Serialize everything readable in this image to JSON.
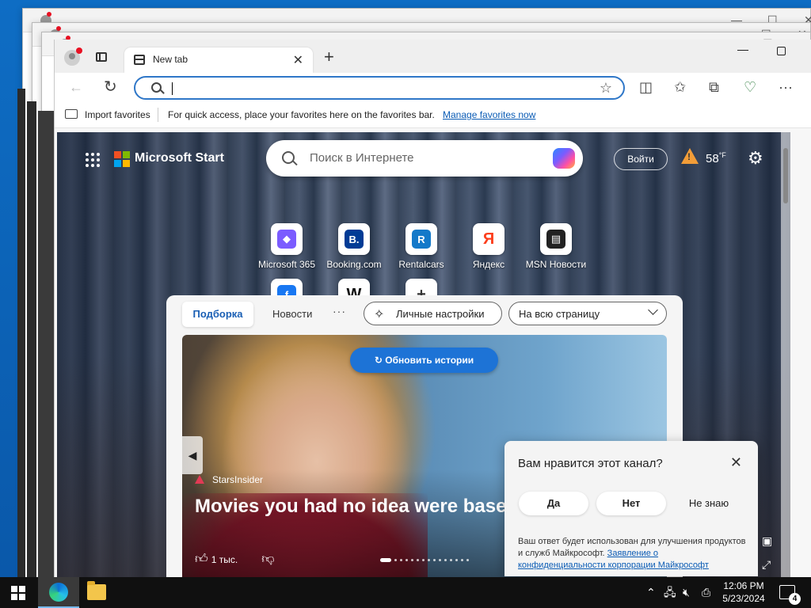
{
  "browser": {
    "tab_title": "New tab",
    "tab_close": "✕",
    "new_tab_symbol": "+",
    "address_value": "",
    "favorites": {
      "import_label": "Import favorites",
      "message": "For quick access, place your favorites here on the favorites bar.",
      "manage_link": "Manage favorites now"
    }
  },
  "start": {
    "brand": "Microsoft Start",
    "search_placeholder": "Поиск в Интернете",
    "login_label": "Войти",
    "temperature": "58",
    "temp_unit": "°F",
    "quick_links": [
      {
        "label": "Microsoft 365",
        "glyph": "◆",
        "color": "#7b5cff"
      },
      {
        "label": "Booking.com",
        "glyph": "B.",
        "color": "#003b95"
      },
      {
        "label": "Rentalcars",
        "glyph": "R",
        "color": "#1479c9"
      },
      {
        "label": "Яндекс",
        "glyph": "Я",
        "color": "#fc3f1d"
      },
      {
        "label": "MSN Новости",
        "glyph": "▤",
        "color": "#222222"
      },
      {
        "label": "Facebook",
        "glyph": "f",
        "color": "#1877f2"
      },
      {
        "label": "Википедия",
        "glyph": "W",
        "color": "#111111"
      },
      {
        "label": "Добавить я...",
        "glyph": "+",
        "color": "#333333"
      }
    ]
  },
  "feed": {
    "tab_selected": "Подборка",
    "tab_news": "Новости",
    "more": "···",
    "personalize_label": "Личные настройки",
    "layout_select": "На всю страницу",
    "refresh_label": "Обновить истории",
    "source": "StarsInsider",
    "headline": "Movies you had no idea were based on plays",
    "likes": "1 тыс."
  },
  "feedback": {
    "question": "Вам нравится этот канал?",
    "yes": "Да",
    "no": "Нет",
    "dont_know": "Не знаю",
    "note": "Ваш ответ будет использован для улучшения продуктов и служб Майкрософт.",
    "note_link": "Заявление о конфиденциальности корпорации Майкрософт"
  },
  "taskbar": {
    "time": "12:06 PM",
    "date": "5/23/2024",
    "notification_count": "4"
  },
  "colors": {
    "accent": "#1d73d6",
    "ms_red": "#f25022",
    "ms_green": "#7fba00",
    "ms_blue": "#00a4ef",
    "ms_yellow": "#ffb900"
  }
}
